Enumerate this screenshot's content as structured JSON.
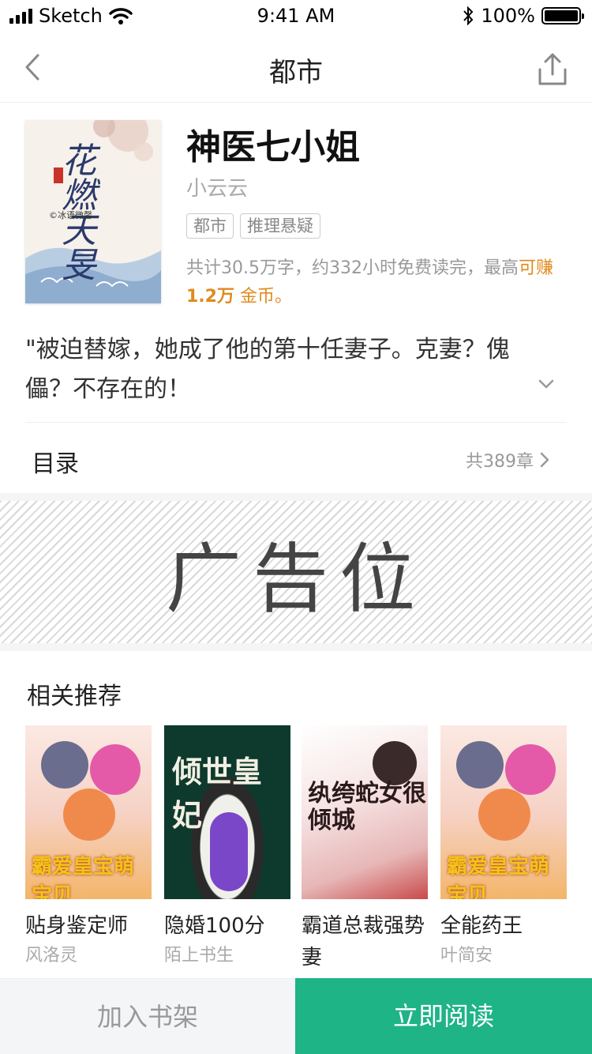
{
  "status_bar": {
    "carrier": "Sketch",
    "time": "9:41 AM",
    "battery": "100%"
  },
  "nav": {
    "title": "都市",
    "back_icon": "chevron-left-icon",
    "share_icon": "share-icon"
  },
  "book": {
    "cover_title": "花燃天旻",
    "cover_author": "©冰语微馨",
    "title": "神医七小姐",
    "author": "小云云",
    "tags": [
      "都市",
      "推理悬疑"
    ],
    "stats_prefix": "共计30.5万字，约332小时免费读完，最高",
    "stats_earn": "可赚",
    "stats_amount": "1.2万",
    "stats_suffix": "金币。",
    "synopsis": "\"被迫替嫁，她成了他的第十任妻子。克妻？傀儡？不存在的！"
  },
  "catalog": {
    "label": "目录",
    "count": "共389章"
  },
  "ad": {
    "label": "广告位"
  },
  "recommend": {
    "title": "相关推荐",
    "items": [
      {
        "name": "贴身鉴定师",
        "author": "风洛灵",
        "cover_text": "霸爱皇宝萌宝贝"
      },
      {
        "name": "隐婚100分",
        "author": "陌上书生",
        "cover_text": "倾世皇妃"
      },
      {
        "name": "霸道总裁强势妻",
        "author": "",
        "cover_text": "纨绔蛇女很倾城"
      },
      {
        "name": "全能药王",
        "author": "叶简安",
        "cover_text": "霸爱皇宝萌宝贝"
      }
    ]
  },
  "bottom": {
    "add_shelf": "加入书架",
    "read_now": "立即阅读"
  },
  "colors": {
    "accent_green": "#1fb486",
    "highlight_orange": "#e08a1e"
  }
}
